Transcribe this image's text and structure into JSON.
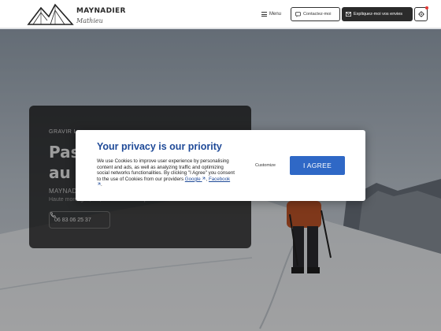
{
  "header": {
    "brand_name": "MAYNADIER",
    "brand_sub": "Mathieu",
    "menu_label": "Menu",
    "contact_label": "Contactez-moi",
    "explain_label": "Expliquez-moi vos envies"
  },
  "hero": {
    "kicker": "GRAVIR L",
    "title_line1": "Pas",
    "title_line2": "au s",
    "subtitle": "MAYNAD",
    "description": "Haute montagne, ski, randonnée au départ",
    "phone": "06 83 06 25 37"
  },
  "privacy": {
    "title": "Your privacy is our priority",
    "body_text": "We use Cookies to improve user experience by personalising content and ads, as well as analyzing traffic and optimizing social networks functionalities. By clicking \"I Agree\" you consent to the use of Cookies from our providers",
    "link_google": "Google",
    "link_facebook": "Facebook",
    "customize_label": "Customize",
    "agree_label": "I AGREE"
  },
  "colors": {
    "accent_blue": "#2f68c6",
    "title_blue": "#1f4a98",
    "dark_button": "#2b2b2b",
    "notification_red": "#e53935"
  },
  "icons": [
    "mountain-logo",
    "hamburger-icon",
    "chat-icon",
    "mail-icon",
    "gear-icon",
    "phone-icon",
    "external-link-icon"
  ]
}
